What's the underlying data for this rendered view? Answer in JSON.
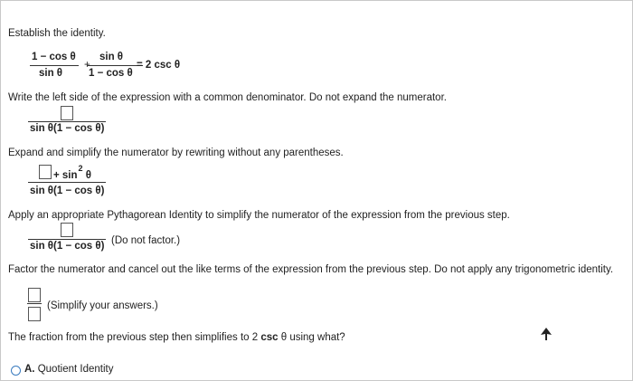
{
  "instruction": "Establish the identity.",
  "identity": {
    "num1": "1 − cos θ",
    "den1": "sin θ",
    "plus": "+",
    "num2": "sin θ",
    "den2": "1 − cos θ",
    "rhs": "= 2 csc θ"
  },
  "step1": {
    "prompt": "Write the left side of the expression with a common denominator. Do not expand the numerator.",
    "denominator": "sin θ(1 − cos θ)"
  },
  "step2": {
    "prompt": "Expand and simplify the numerator by rewriting without any parentheses.",
    "numerator_suffix": "+ sin",
    "exponent": "2",
    "numerator_var": "θ",
    "denominator": "sin θ(1 − cos θ)"
  },
  "step3": {
    "prompt": "Apply an appropriate Pythagorean Identity to simplify the numerator of the expression from the previous step.",
    "denominator": "sin θ(1 − cos θ)",
    "hint": "(Do not factor.)"
  },
  "step4": {
    "prompt": "Factor the numerator and cancel out the like terms of the expression from the previous step. Do not apply any trigonometric identity.",
    "hint": "(Simplify your answers.)"
  },
  "step5": {
    "prompt_pre": "The fraction from the previous step then simplifies to 2",
    "prompt_csc": "csc",
    "prompt_post": "θ using what?"
  },
  "options": [
    {
      "letter": "A.",
      "label": "Quotient Identity"
    }
  ]
}
